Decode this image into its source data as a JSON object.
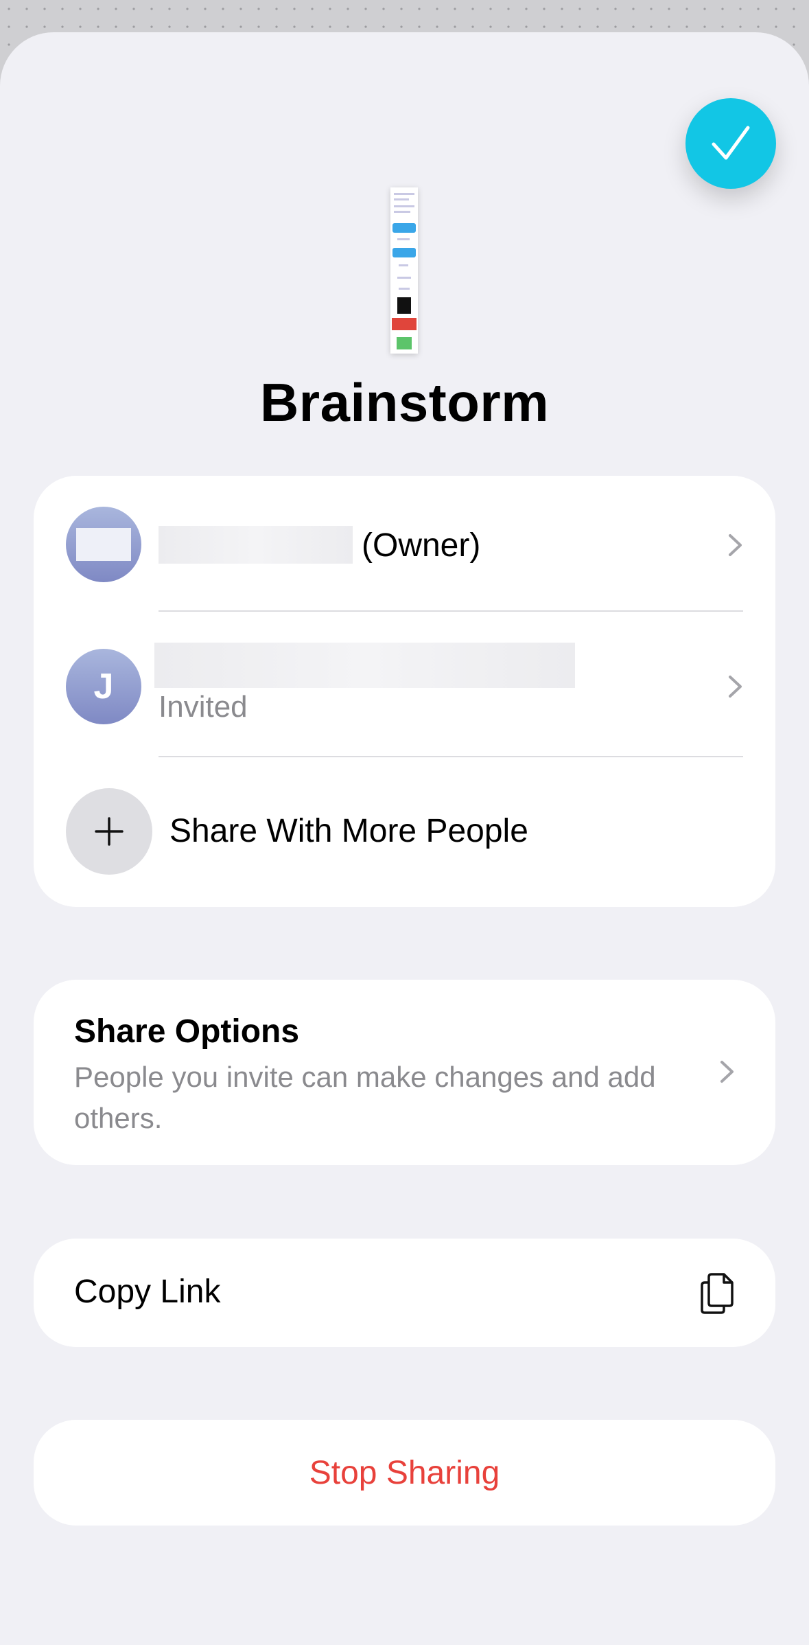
{
  "document": {
    "title": "Brainstorm"
  },
  "people": [
    {
      "name_redacted": true,
      "role": "(Owner)"
    },
    {
      "avatar_initial": "J",
      "name_redacted": true,
      "status": "Invited"
    }
  ],
  "share_more": {
    "label": "Share With More People"
  },
  "share_options": {
    "title": "Share Options",
    "description": "People you invite can make changes and add others."
  },
  "copy_link": {
    "label": "Copy Link"
  },
  "stop_sharing": {
    "label": "Stop Sharing"
  },
  "icons": {
    "done": "checkmark-icon",
    "chevron": "chevron-right-icon",
    "plus": "plus-icon",
    "copy": "copy-link-icon"
  },
  "colors": {
    "accent": "#12c6e5",
    "destructive": "#e8413b",
    "secondary_text": "#8a8a8e",
    "sheet_background": "#f0f0f5"
  }
}
